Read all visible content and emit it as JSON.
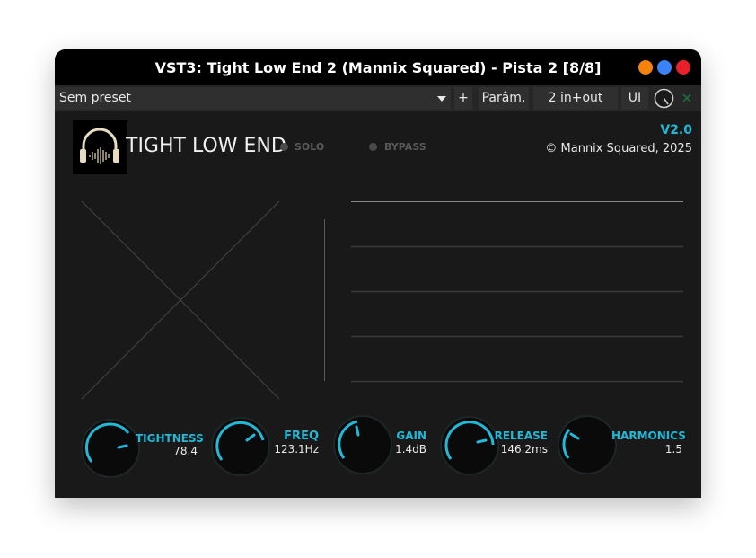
{
  "window": {
    "title": "VST3: Tight Low End 2 (Mannix Squared) - Pista 2 [8/8]",
    "controls": {
      "minimize_color": "#f5820b",
      "maximize_color": "#3b82f6",
      "close_color": "#e8202a"
    }
  },
  "toolbar": {
    "preset": "Sem preset",
    "add_label": "+",
    "params_label": "Parâm.",
    "io_label": "2 in+out",
    "ui_label": "UI"
  },
  "plugin": {
    "name": "TIGHT LOW END",
    "solo_label": "SOLO",
    "bypass_label": "BYPASS",
    "version": "V2.0",
    "copyright": "© Mannix Squared, 2025",
    "accent_color": "#22b8d6",
    "knobs": [
      {
        "label": "TIGHTNESS",
        "value": "78.4"
      },
      {
        "label": "FREQ",
        "value": "123.1Hz"
      },
      {
        "label": "GAIN",
        "value": "1.4dB"
      },
      {
        "label": "RELEASE",
        "value": "146.2ms"
      },
      {
        "label": "HARMONICS",
        "value": "1.5"
      }
    ]
  }
}
